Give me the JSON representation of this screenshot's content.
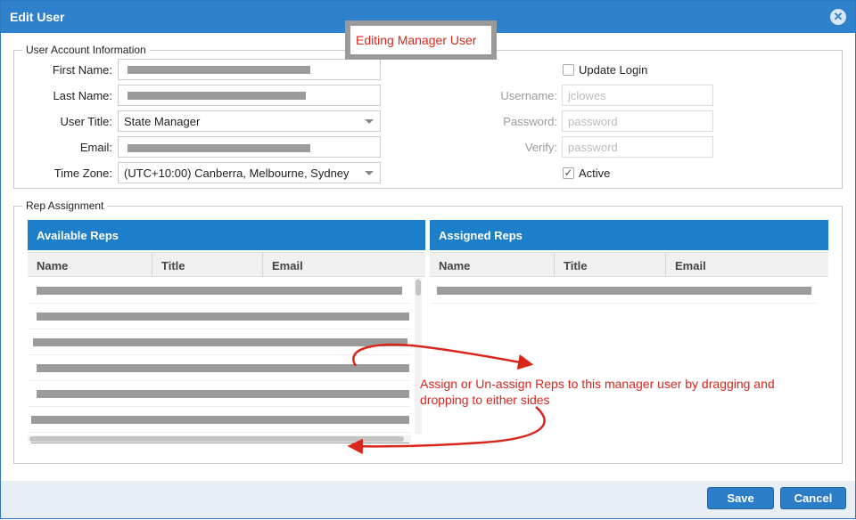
{
  "dialog": {
    "title": "Edit User",
    "close_symbol": "✕"
  },
  "callout": {
    "text": "Editing Manager User"
  },
  "account": {
    "legend": "User Account Information",
    "first_name_label": "First Name:",
    "last_name_label": "Last Name:",
    "user_title_label": "User Title:",
    "user_title_value": "State Manager",
    "email_label": "Email:",
    "time_zone_label": "Time Zone:",
    "time_zone_value": "(UTC+10:00) Canberra, Melbourne, Sydney",
    "update_login_label": "Update Login",
    "username_label": "Username:",
    "username_value": "jclowes",
    "password_label": "Password:",
    "password_placeholder": "password",
    "verify_label": "Verify:",
    "verify_placeholder": "password",
    "active_label": "Active",
    "active_check": "✓"
  },
  "reps": {
    "legend": "Rep Assignment",
    "available_title": "Available Reps",
    "assigned_title": "Assigned Reps",
    "columns": [
      "Name",
      "Title",
      "Email"
    ]
  },
  "annotation": {
    "text": "Assign or Un-assign Reps to this manager user by dragging and dropping to either sides"
  },
  "buttons": {
    "save": "Save",
    "cancel": "Cancel"
  },
  "colors": {
    "header_blue": "#2f81cc",
    "grid_blue": "#1d7fca",
    "annotation_red": "#d9261c"
  }
}
